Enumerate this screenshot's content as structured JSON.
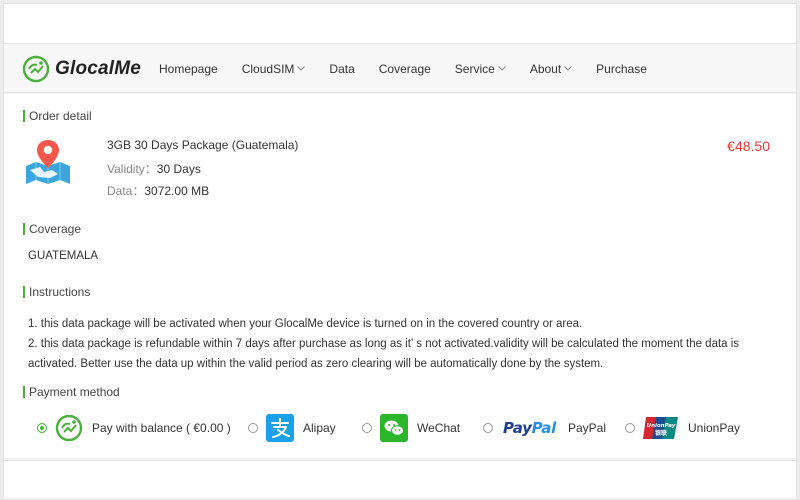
{
  "brand": {
    "name": "GlocalMe",
    "accent": "#4caf3e"
  },
  "nav": {
    "items": [
      {
        "label": "Homepage",
        "dropdown": false
      },
      {
        "label": "CloudSIM",
        "dropdown": true
      },
      {
        "label": "Data",
        "dropdown": false
      },
      {
        "label": "Coverage",
        "dropdown": false
      },
      {
        "label": "Service",
        "dropdown": true
      },
      {
        "label": "About",
        "dropdown": true
      },
      {
        "label": "Purchase",
        "dropdown": false
      }
    ]
  },
  "order": {
    "section_title": "Order detail",
    "icon": "map-pin-icon",
    "package_name": "3GB 30 Days Package (Guatemala)",
    "validity_label": "Validity：",
    "validity_value": "30 Days",
    "data_label": "Data：",
    "data_value": "3072.00 MB",
    "price": "€48.50",
    "price_color": "#e53935"
  },
  "coverage": {
    "section_title": "Coverage",
    "country": "GUATEMALA"
  },
  "instructions": {
    "section_title": "Instructions",
    "line1": "1. this data package will be activated when your GlocalMe device is turned on in the covered country or area.",
    "line2": "2. this data package is refundable within 7 days after purchase as long as it’ s not activated.validity will be calculated the moment the data is activated. Better use the data up within the valid period as zero clearing will be automatically done by the system."
  },
  "payment": {
    "section_title": "Payment method",
    "options": [
      {
        "label": "Pay with balance ( €0.00 )",
        "icon": "glocalme-logo-icon",
        "selected": true
      },
      {
        "label": "Alipay",
        "icon": "alipay-icon",
        "selected": false
      },
      {
        "label": "WeChat",
        "icon": "wechat-icon",
        "selected": false
      },
      {
        "label": "PayPal",
        "icon": "paypal-logo",
        "logo_text_a": "Pay",
        "logo_text_b": "Pal",
        "selected": false
      },
      {
        "label": "UnionPay",
        "icon": "unionpay-icon",
        "logo_text": "UnionPay",
        "logo_text_cn": "银联",
        "selected": false
      }
    ]
  }
}
